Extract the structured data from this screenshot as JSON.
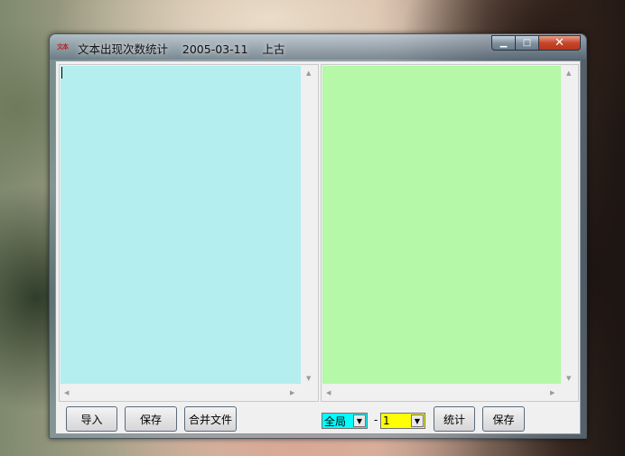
{
  "window": {
    "icon_text": "文本",
    "title": "文本出现次数统计    2005-03-11    上古",
    "controls": {
      "minimize": "▁",
      "maximize": "□",
      "close": "✕"
    }
  },
  "left_pane": {
    "text": ""
  },
  "right_pane": {
    "text": ""
  },
  "buttons": {
    "import": "导入",
    "save_left": "保存",
    "merge_files": "合并文件",
    "count": "统计",
    "save_right": "保存"
  },
  "scope_select": {
    "value": "全局",
    "bg": "#00ffff"
  },
  "separator": "-",
  "number_select": {
    "value": "1",
    "bg": "#ffff00"
  },
  "colors": {
    "left_area": "#b4eeee",
    "right_area": "#b4f8a8"
  }
}
